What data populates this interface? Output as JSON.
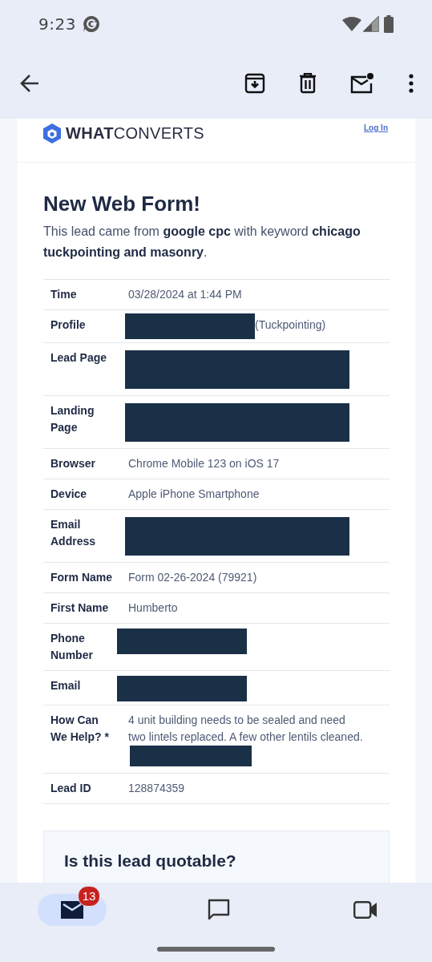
{
  "status_bar": {
    "time": "9:23"
  },
  "email": {
    "brand": {
      "bold": "WHAT",
      "light": "CONVERTS"
    },
    "login_link": "Log In",
    "heading": "New Web Form!",
    "intro": "This lead came from **google cpc** with keyword **chicago tuckpointing and masonry**.",
    "details": [
      {
        "label": "Time",
        "value": "03/28/2024 at 1:44 PM",
        "kind": "plain"
      },
      {
        "label": "Profile",
        "value": "(Tuckpointing)",
        "kind": "prefixredacted"
      },
      {
        "label": "Lead Page",
        "kind": "tallredacted"
      },
      {
        "label": "Landing Page",
        "kind": "tallredacted"
      },
      {
        "label": "Browser",
        "value": "Chrome Mobile 123 on iOS 17",
        "kind": "plain"
      },
      {
        "label": "Device",
        "value": "Apple iPhone Smartphone",
        "kind": "plain"
      },
      {
        "label": "Email Address",
        "kind": "tallredacted"
      },
      {
        "label": "Form Name",
        "value": "Form 02-26-2024 (79921)",
        "kind": "plain"
      },
      {
        "label": "First Name",
        "value": "Humberto",
        "kind": "plain"
      },
      {
        "label": "Phone Number",
        "kind": "shortredacted"
      },
      {
        "label": "Email",
        "kind": "shortredacted"
      },
      {
        "label": "How Can We Help? *",
        "value": "4 unit building needs to be sealed and need two lintels replaced. A few other lentils cleaned.",
        "kind": "suffixredacted"
      },
      {
        "label": "Lead ID",
        "value": "128874359",
        "kind": "plain"
      }
    ],
    "quotable_heading": "Is this lead quotable?"
  },
  "bottom_nav": {
    "items": [
      {
        "kind": "mail",
        "selected": true,
        "badge": "13"
      },
      {
        "kind": "chat",
        "selected": false
      },
      {
        "kind": "video",
        "selected": false
      }
    ]
  }
}
